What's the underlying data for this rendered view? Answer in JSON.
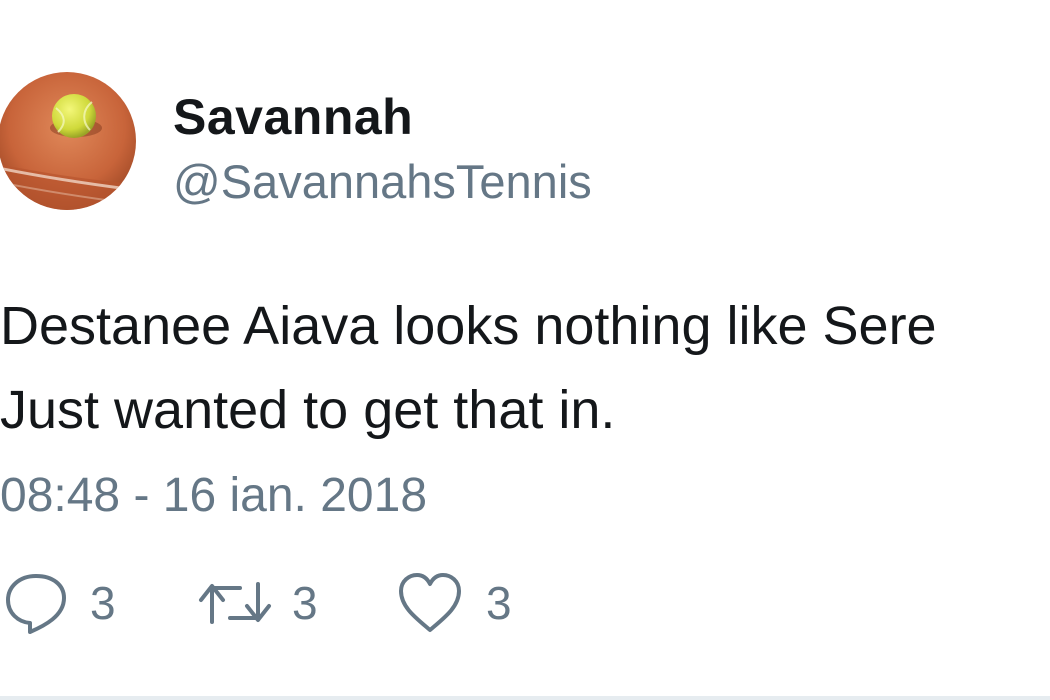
{
  "user": {
    "display_name": "Savannah",
    "handle": "@SavannahsTennis",
    "avatar": "tennis-ball-on-clay-court"
  },
  "tweet": {
    "lines": [
      "Destanee Aiava looks nothing like Sere",
      "Just wanted to get that in."
    ],
    "timestamp": "08:48 - 16 ian. 2018"
  },
  "actions": {
    "reply": {
      "icon": "reply-icon",
      "count": "3"
    },
    "retweet": {
      "icon": "retweet-icon",
      "count": "3"
    },
    "like": {
      "icon": "heart-icon",
      "count": "3"
    }
  },
  "colors": {
    "text_primary": "#14171a",
    "text_secondary": "#657786",
    "divider": "#e6ecf0",
    "avatar_clay": "#c8643a",
    "avatar_ball": "#d6e03a"
  }
}
